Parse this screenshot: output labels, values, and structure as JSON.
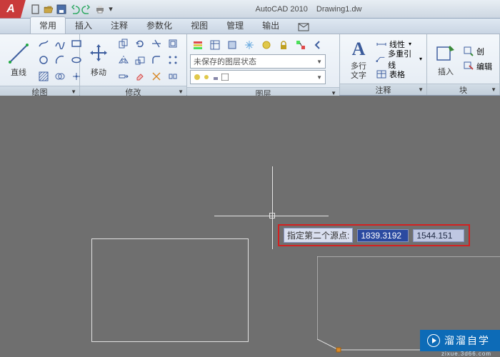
{
  "title": {
    "app": "AutoCAD 2010",
    "doc": "Drawing1.dw"
  },
  "tabs": {
    "t0": "常用",
    "t1": "插入",
    "t2": "注释",
    "t3": "参数化",
    "t4": "视图",
    "t5": "管理",
    "t6": "输出"
  },
  "panels": {
    "draw": "绘图",
    "modify": "修改",
    "layer": "图层",
    "annotate": "注释",
    "block": "块"
  },
  "tools": {
    "line": "直线",
    "move": "移动",
    "mtext": "多行\n文字",
    "insert": "插入"
  },
  "layer_state": "未保存的图层状态",
  "ann": {
    "linear": "线性",
    "mleader": "多重引线",
    "table": "表格"
  },
  "block_cmds": {
    "create": "创",
    "edit": "编辑"
  },
  "prompt": {
    "label": "指定第二个源点:",
    "x": "1839.3192",
    "y": "1544.151"
  },
  "watermark": {
    "main": "溜溜自学",
    "sub": "zixue.3d66.com"
  }
}
